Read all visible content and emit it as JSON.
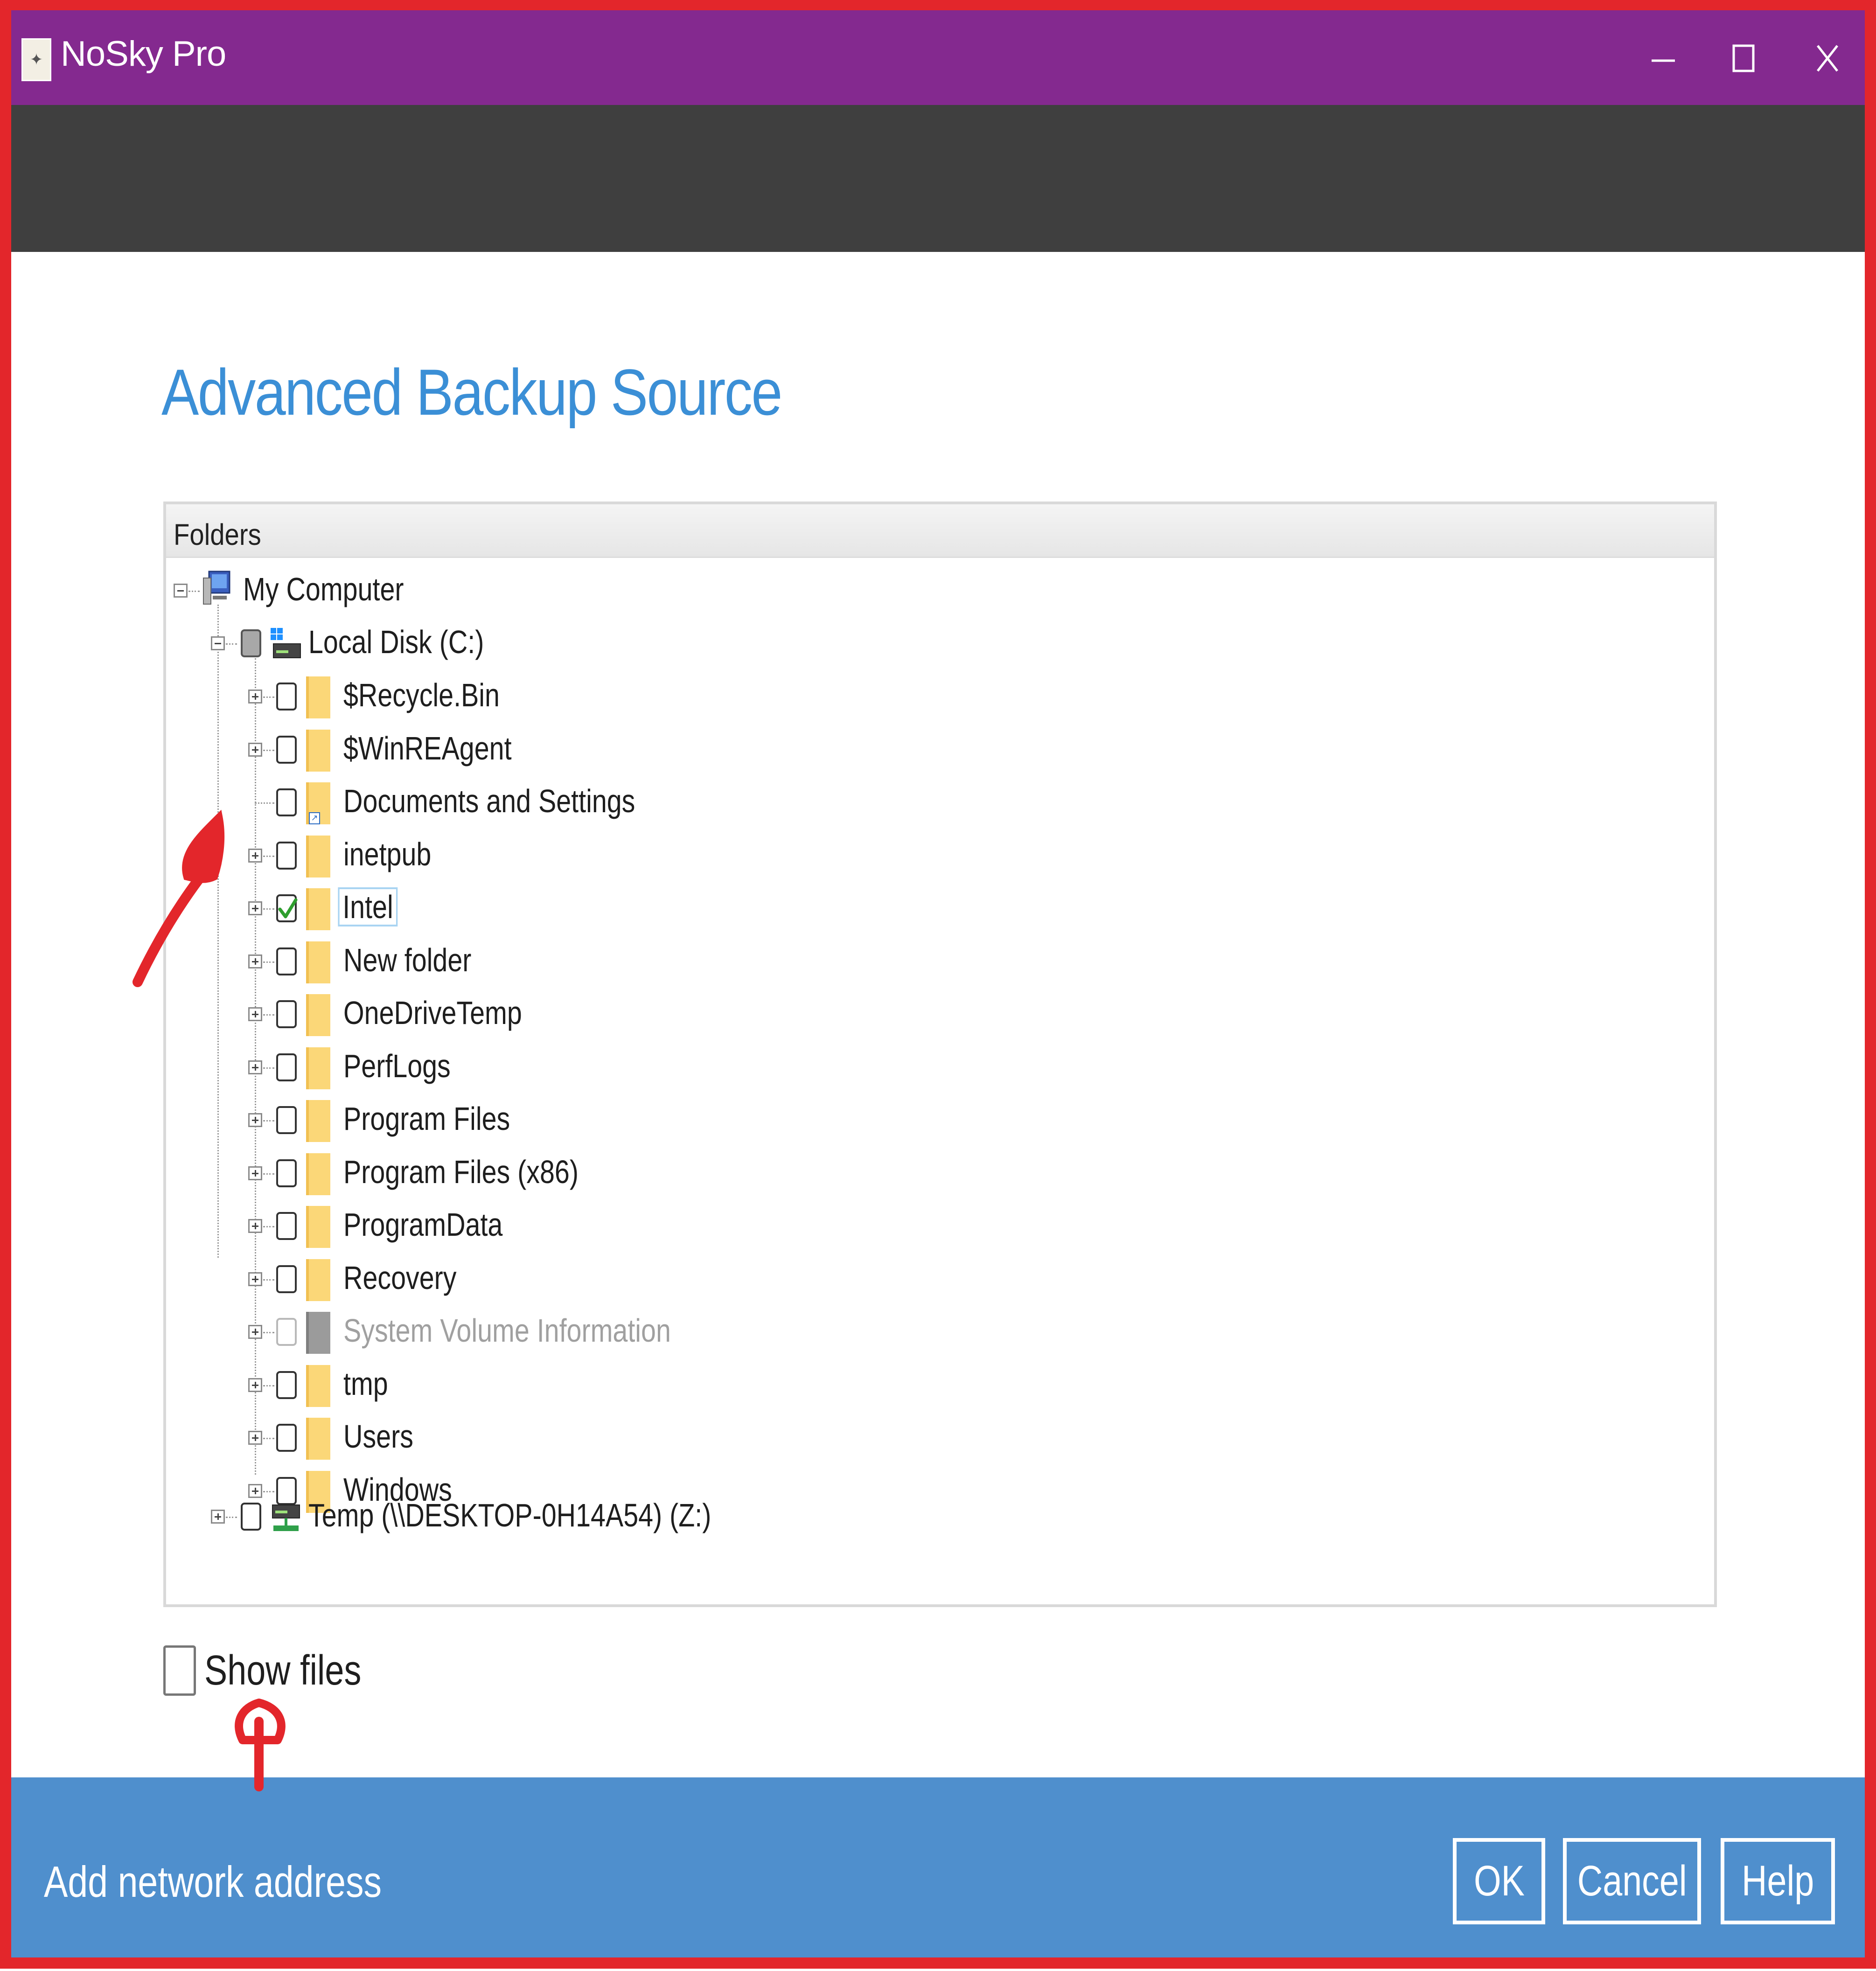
{
  "window": {
    "title": "NoSky Pro",
    "icon": "app-logo-icon",
    "controls": [
      "minimize-icon",
      "maximize-icon",
      "close-icon"
    ],
    "title_bar_color": "#84298f",
    "toolbar_color": "#3f3f3f"
  },
  "page": {
    "title": "Advanced Backup Source",
    "title_color": "#3b8fd6"
  },
  "tree": {
    "header": "Folders",
    "root": {
      "label": "My Computer",
      "icon": "computer-icon",
      "expanded": true
    },
    "drives": [
      {
        "label": "Local Disk (C:)",
        "icon": "local-disk-icon",
        "expanded": true,
        "check_state": "partial"
      },
      {
        "label": "Temp (\\\\DESKTOP-0H14A54) (Z:)",
        "icon": "network-drive-icon",
        "expanded": false,
        "check_state": "unchecked"
      }
    ],
    "folders": [
      {
        "label": "$Recycle.Bin",
        "check_state": "unchecked",
        "expandable": true
      },
      {
        "label": "$WinREAgent",
        "check_state": "unchecked",
        "expandable": true
      },
      {
        "label": "Documents and Settings",
        "check_state": "unchecked",
        "expandable": false,
        "icon": "shortcut-folder-icon"
      },
      {
        "label": "inetpub",
        "check_state": "unchecked",
        "expandable": true
      },
      {
        "label": "Intel",
        "check_state": "checked",
        "expandable": true,
        "selected": true
      },
      {
        "label": "New folder",
        "check_state": "unchecked",
        "expandable": true
      },
      {
        "label": "OneDriveTemp",
        "check_state": "unchecked",
        "expandable": true
      },
      {
        "label": "PerfLogs",
        "check_state": "unchecked",
        "expandable": true
      },
      {
        "label": "Program Files",
        "check_state": "unchecked",
        "expandable": true
      },
      {
        "label": "Program Files (x86)",
        "check_state": "unchecked",
        "expandable": true
      },
      {
        "label": "ProgramData",
        "check_state": "unchecked",
        "expandable": true
      },
      {
        "label": "Recovery",
        "check_state": "unchecked",
        "expandable": true
      },
      {
        "label": "System Volume Information",
        "check_state": "disabled",
        "expandable": true,
        "icon": "system-folder-icon"
      },
      {
        "label": "tmp",
        "check_state": "unchecked",
        "expandable": true
      },
      {
        "label": "Users",
        "check_state": "unchecked",
        "expandable": true
      },
      {
        "label": "Windows",
        "check_state": "unchecked",
        "expandable": true
      }
    ]
  },
  "options": {
    "show_files_label": "Show files",
    "show_files_checked": false
  },
  "footer": {
    "add_network_label": "Add network address",
    "ok_label": "OK",
    "cancel_label": "Cancel",
    "help_label": "Help",
    "color": "#4f8fcd"
  },
  "annotations": {
    "color": "#e3262b",
    "items": [
      "red-arrow-to-checkbox-column",
      "red-arrow-to-show-files"
    ]
  }
}
